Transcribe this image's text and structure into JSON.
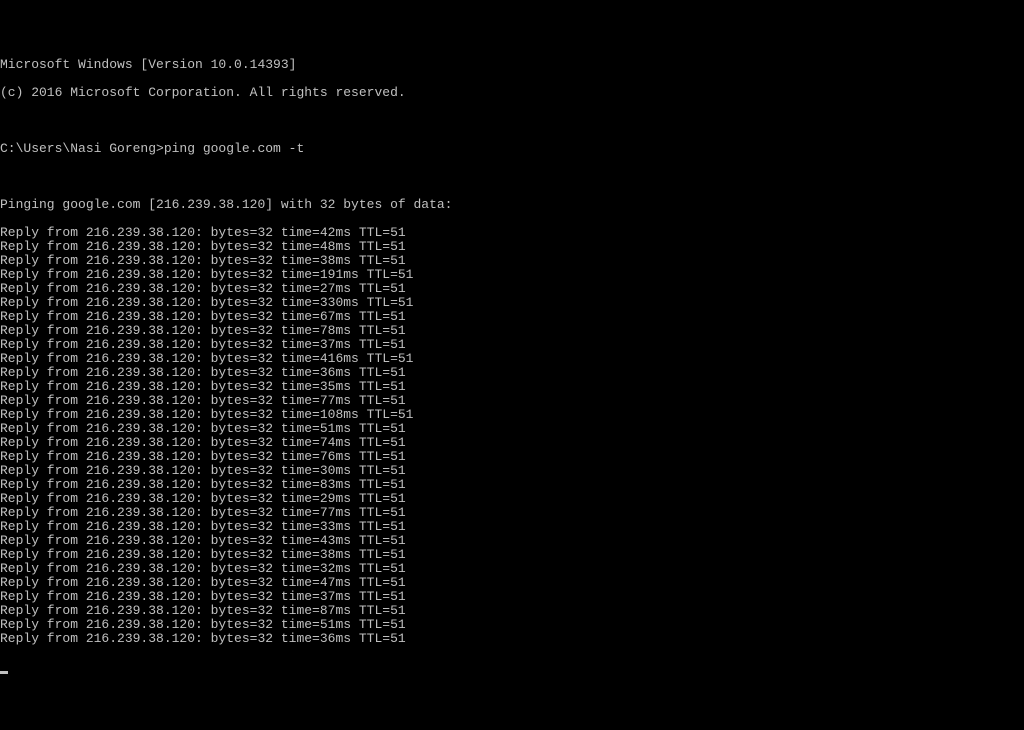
{
  "header": {
    "line1": "Microsoft Windows [Version 10.0.14393]",
    "line2": "(c) 2016 Microsoft Corporation. All rights reserved."
  },
  "prompt": {
    "path": "C:\\Users\\Nasi Goreng>",
    "command": "ping google.com -t"
  },
  "ping": {
    "header": "Pinging google.com [216.239.38.120] with 32 bytes of data:",
    "host": "216.239.38.120",
    "bytes": 32,
    "ttl": 51,
    "replies": [
      {
        "time": "42ms"
      },
      {
        "time": "48ms"
      },
      {
        "time": "38ms"
      },
      {
        "time": "191ms"
      },
      {
        "time": "27ms"
      },
      {
        "time": "330ms"
      },
      {
        "time": "67ms"
      },
      {
        "time": "78ms"
      },
      {
        "time": "37ms"
      },
      {
        "time": "416ms"
      },
      {
        "time": "36ms"
      },
      {
        "time": "35ms"
      },
      {
        "time": "77ms"
      },
      {
        "time": "108ms"
      },
      {
        "time": "51ms"
      },
      {
        "time": "74ms"
      },
      {
        "time": "76ms"
      },
      {
        "time": "30ms"
      },
      {
        "time": "83ms"
      },
      {
        "time": "29ms"
      },
      {
        "time": "77ms"
      },
      {
        "time": "33ms"
      },
      {
        "time": "43ms"
      },
      {
        "time": "38ms"
      },
      {
        "time": "32ms"
      },
      {
        "time": "47ms"
      },
      {
        "time": "37ms"
      },
      {
        "time": "87ms"
      },
      {
        "time": "51ms"
      },
      {
        "time": "36ms"
      }
    ]
  }
}
